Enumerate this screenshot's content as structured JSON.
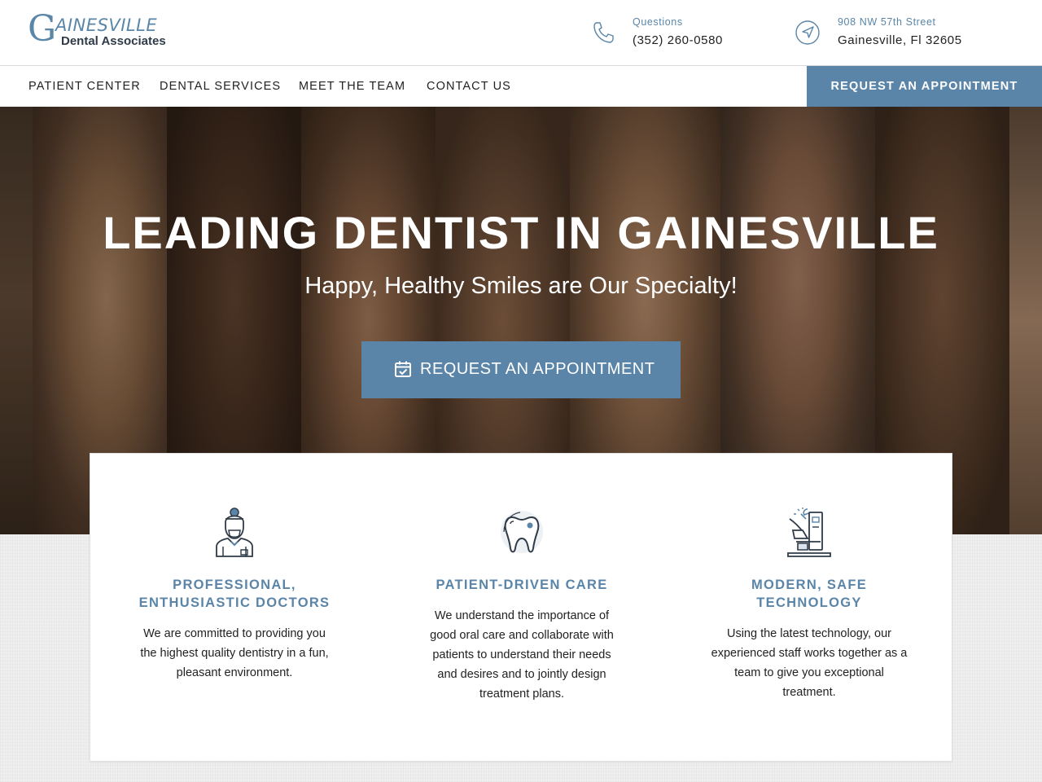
{
  "header": {
    "logo": {
      "big_letter": "G",
      "top_word": "AINESVILLE",
      "bottom_line": "Dental Associates"
    },
    "phone": {
      "icon": "phone-icon",
      "label": "Questions",
      "value": "(352) 260-0580"
    },
    "address": {
      "icon": "navigation-arrow-icon",
      "label": "908 NW 57th Street",
      "value": "Gainesville, Fl 32605"
    }
  },
  "nav": {
    "items": [
      {
        "label": "PATIENT CENTER"
      },
      {
        "label": "DENTAL SERVICES"
      },
      {
        "label": "MEET THE TEAM"
      },
      {
        "label": "CONTACT US"
      }
    ],
    "cta_label": "REQUEST AN APPOINTMENT"
  },
  "hero": {
    "title": "LEADING DENTIST IN GAINESVILLE",
    "subtitle": "Happy, Healthy Smiles are Our Specialty!",
    "button_icon": "calendar-check-icon",
    "button_label": "REQUEST AN APPOINTMENT"
  },
  "features": [
    {
      "icon": "dentist-doctor-icon",
      "title_line1": "PROFESSIONAL,",
      "title_line2": "ENTHUSIASTIC DOCTORS",
      "text": "We are committed to providing you the highest quality dentistry in a fun, pleasant environment."
    },
    {
      "icon": "tooth-icon",
      "title_line1": "PATIENT-DRIVEN CARE",
      "title_line2": "",
      "text": "We understand the importance of good oral care and collaborate with patients to understand their needs and desires and to jointly design treatment plans."
    },
    {
      "icon": "dental-chair-icon",
      "title_line1": "MODERN, SAFE",
      "title_line2": "TECHNOLOGY",
      "text": "Using the latest technology, our experienced staff works together as a team to give you exceptional treatment."
    }
  ],
  "colors": {
    "accent": "#5b85a8",
    "title_text": "#ffffff",
    "body_text": "#222222"
  }
}
